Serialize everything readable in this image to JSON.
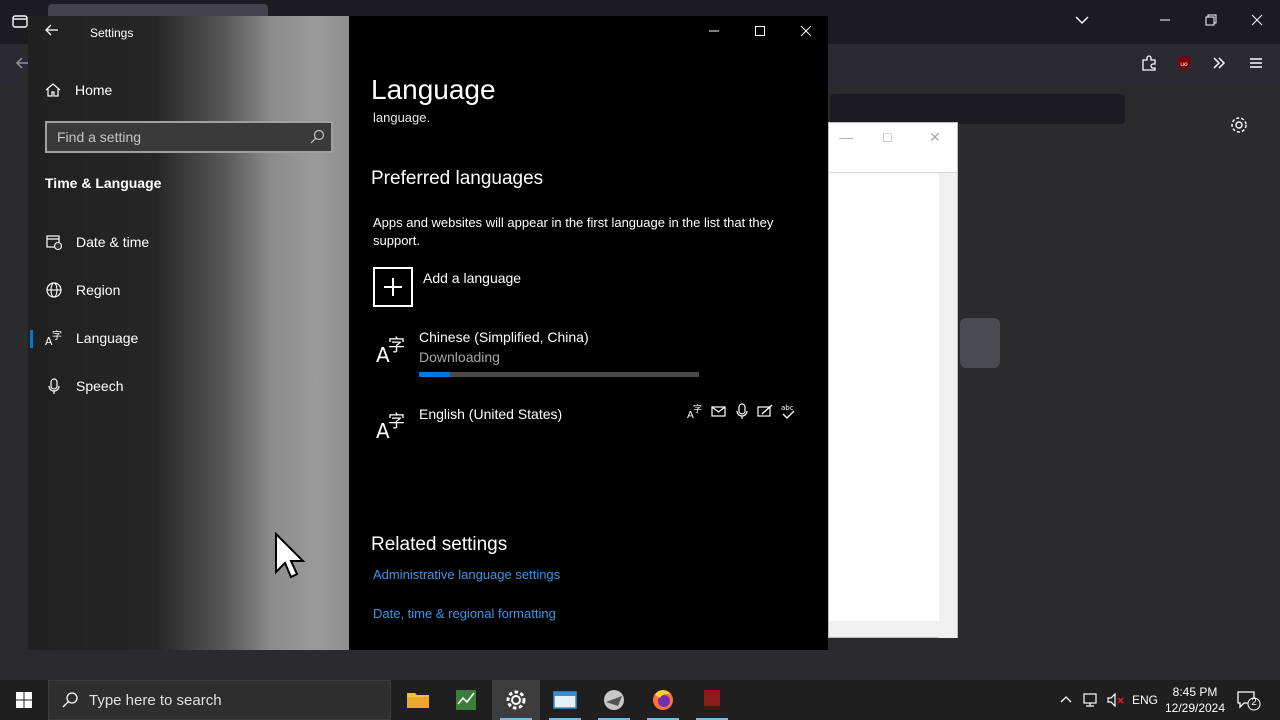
{
  "settings": {
    "app_title": "Settings",
    "nav": {
      "home": "Home",
      "search_placeholder": "Find a setting",
      "section": "Time & Language",
      "items": [
        {
          "label": "Date & time",
          "icon": "calendar-clock-icon"
        },
        {
          "label": "Region",
          "icon": "globe-icon"
        },
        {
          "label": "Language",
          "icon": "language-icon",
          "active": true
        },
        {
          "label": "Speech",
          "icon": "microphone-icon"
        }
      ]
    },
    "content": {
      "page_title": "Language",
      "cut_text": "language.",
      "preferred_heading": "Preferred languages",
      "preferred_desc": "Apps and websites will appear in the first language in the list that they support.",
      "add_language": "Add a language",
      "languages": [
        {
          "name": "Chinese (Simplified, China)",
          "status": "Downloading",
          "progress": 0.11
        },
        {
          "name": "English (United States)",
          "features": [
            "display-language-icon",
            "text-to-speech-icon",
            "speech-recognition-icon",
            "handwriting-icon",
            "spell-check-icon"
          ]
        }
      ],
      "related_heading": "Related settings",
      "links": [
        "Administrative language settings",
        "Date, time & regional formatting"
      ]
    }
  },
  "taskbar": {
    "search_placeholder": "Type here to search",
    "language": "ENG",
    "time": "8:45 PM",
    "date": "12/29/2024",
    "notification_count": "2",
    "apps": [
      "file-explorer-icon",
      "task-manager-icon",
      "settings-icon",
      "notepad-icon",
      "app-icon",
      "firefox-icon",
      "book-icon"
    ]
  },
  "colors": {
    "accent": "#0078d7",
    "link": "#3d95e6",
    "content_bg": "#000000"
  }
}
